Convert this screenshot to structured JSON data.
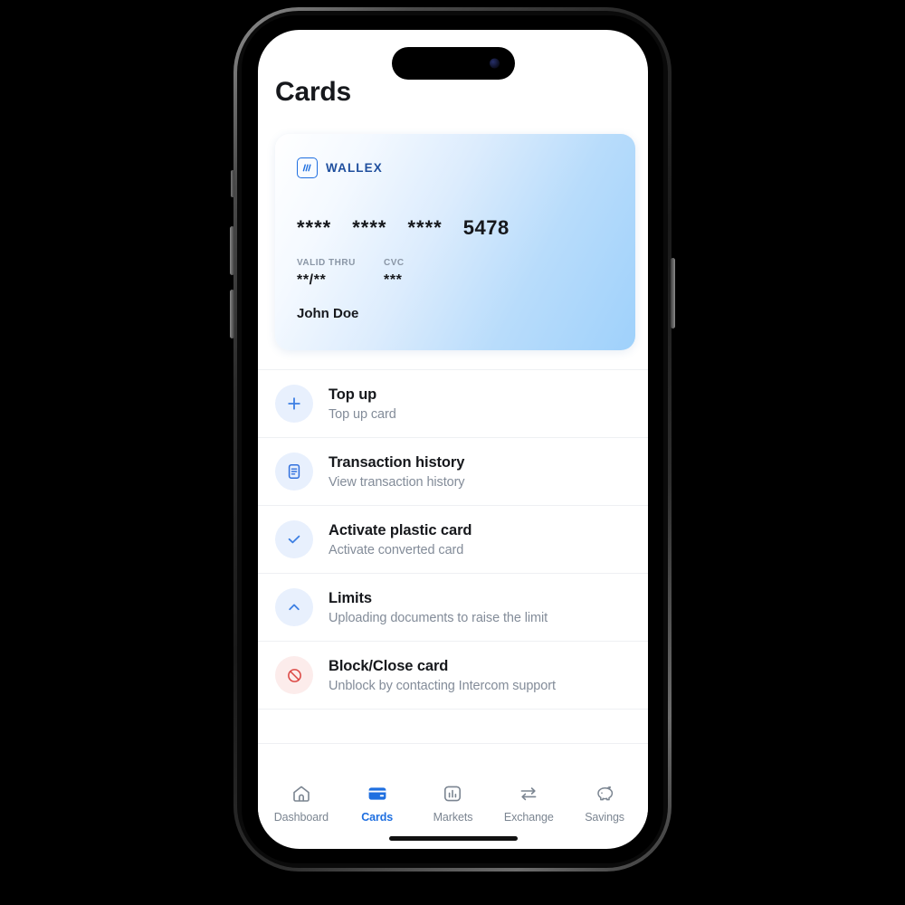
{
  "screen": {
    "page_title": "Cards"
  },
  "bank_card": {
    "brand_name": "WALLEX",
    "brand_icon": "wallex-logo-icon",
    "number_groups": [
      "****",
      "****",
      "****"
    ],
    "number_last4": "5478",
    "valid_thru_label": "VALID THRU",
    "valid_thru_value": "**/**",
    "cvc_label": "CVC",
    "cvc_value": "***",
    "holder_name": "John Doe",
    "gradient_from": "#ffffff",
    "gradient_to": "#9fd1fb"
  },
  "menu": {
    "items": [
      {
        "title": "Top up",
        "subtitle": "Top up card",
        "icon": "plus-icon",
        "icon_tone": "blue"
      },
      {
        "title": "Transaction history",
        "subtitle": "View transaction history",
        "icon": "document-list-icon",
        "icon_tone": "blue"
      },
      {
        "title": "Activate plastic card",
        "subtitle": "Activate converted card",
        "icon": "check-icon",
        "icon_tone": "blue"
      },
      {
        "title": "Limits",
        "subtitle": "Uploading documents to raise the limit",
        "icon": "chevron-up-icon",
        "icon_tone": "blue"
      },
      {
        "title": "Block/Close card",
        "subtitle": "Unblock by contacting Intercom support",
        "icon": "block-icon",
        "icon_tone": "red"
      }
    ]
  },
  "tabbar": {
    "active_color": "#1f6fe0",
    "inactive_color": "#7b8591",
    "items": [
      {
        "label": "Dashboard",
        "icon": "home-icon",
        "active": false
      },
      {
        "label": "Cards",
        "icon": "card-icon",
        "active": true
      },
      {
        "label": "Markets",
        "icon": "markets-icon",
        "active": false
      },
      {
        "label": "Exchange",
        "icon": "exchange-icon",
        "active": false
      },
      {
        "label": "Savings",
        "icon": "piggy-bank-icon",
        "active": false
      }
    ]
  }
}
